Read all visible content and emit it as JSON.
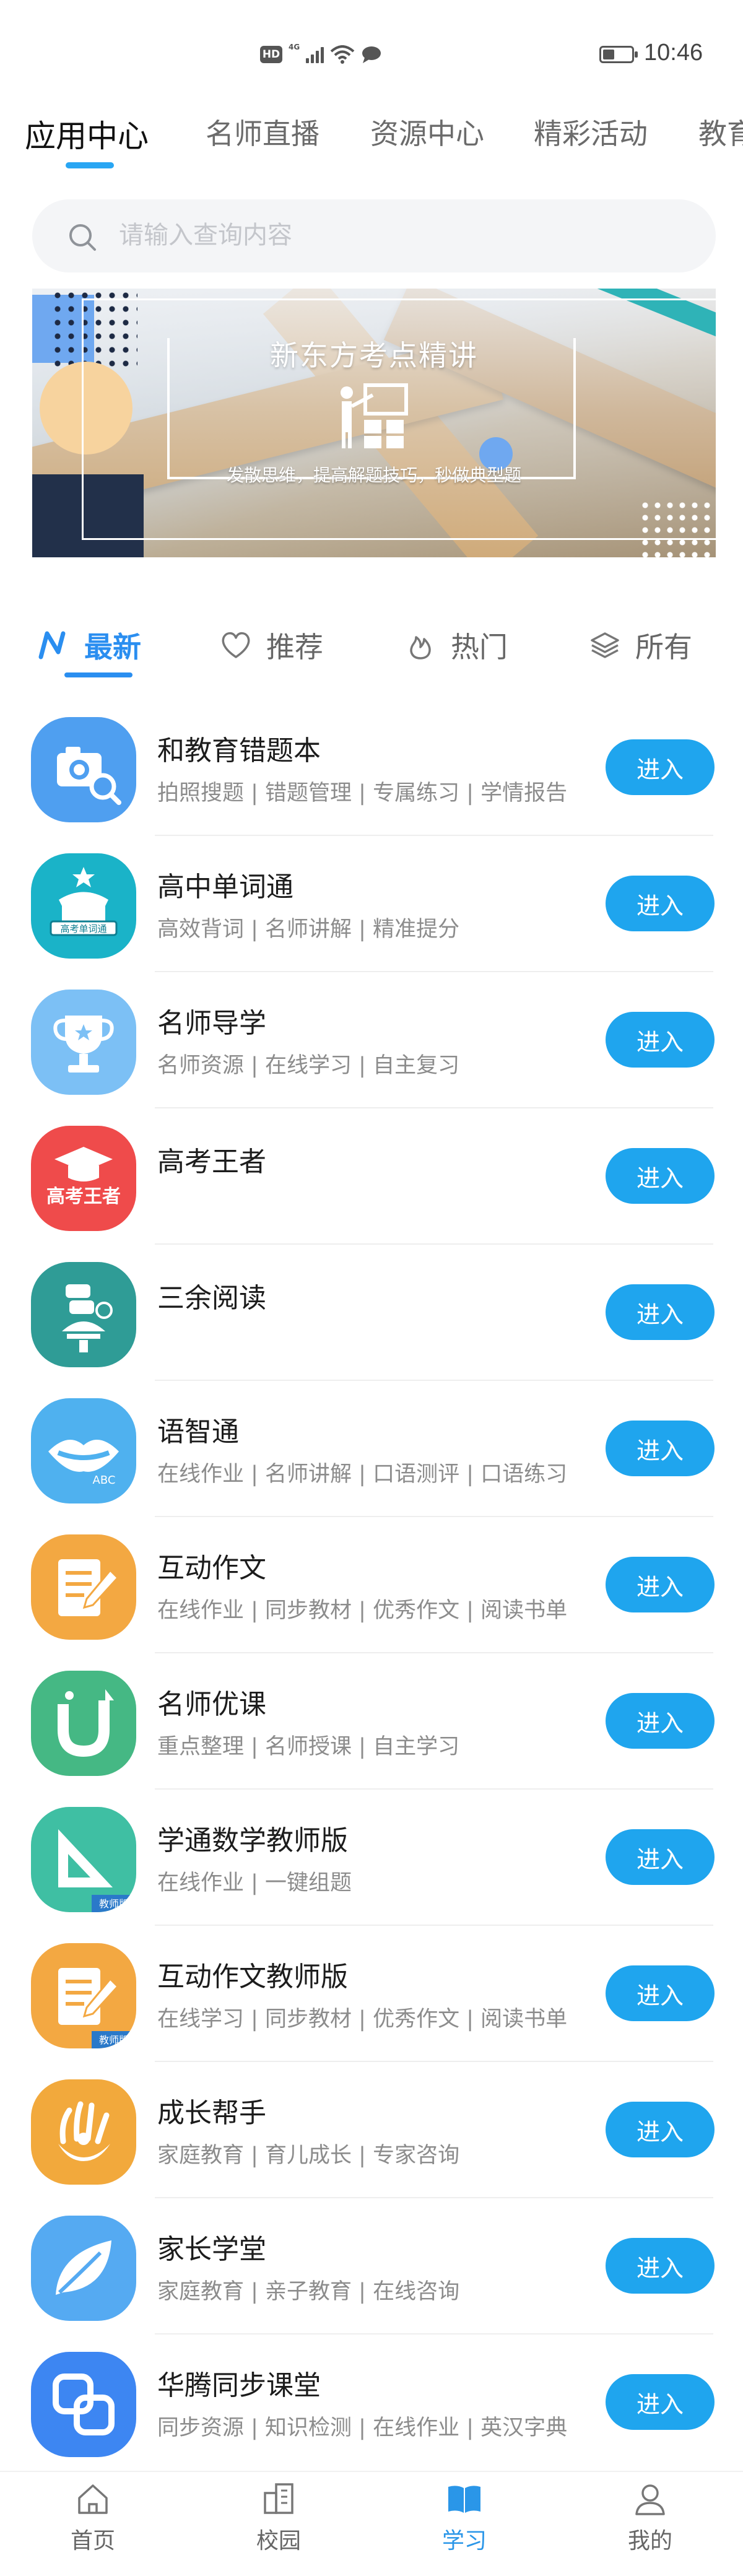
{
  "status_bar": {
    "badge": "HD",
    "network": "4G",
    "time": "10:46"
  },
  "top_tabs": [
    {
      "label": "应用中心",
      "active": true
    },
    {
      "label": "名师直播",
      "active": false
    },
    {
      "label": "资源中心",
      "active": false
    },
    {
      "label": "精彩活动",
      "active": false
    },
    {
      "label": "教育",
      "active": false
    }
  ],
  "search": {
    "placeholder": "请输入查询内容"
  },
  "banner": {
    "title": "新东方考点精讲",
    "subtitle": "发散思维，提高解题技巧，秒做典型题"
  },
  "category_tabs": [
    {
      "label": "最新",
      "icon": "lightning-n-icon",
      "active": true
    },
    {
      "label": "推荐",
      "icon": "heart-icon",
      "active": false
    },
    {
      "label": "热门",
      "icon": "flame-icon",
      "active": false
    },
    {
      "label": "所有",
      "icon": "layers-icon",
      "active": false
    }
  ],
  "enter_label": "进入",
  "apps": [
    {
      "name": "和教育错题本",
      "desc": "拍照搜题 | 错题管理 | 专属练习 | 学情报告",
      "icon": "camera-search-icon"
    },
    {
      "name": "高中单词通",
      "desc": "高效背词 | 名师讲解 | 精准提分",
      "icon": "word-pass-icon",
      "icon_text": "高考单词通"
    },
    {
      "name": "名师导学",
      "desc": "名师资源 | 在线学习 | 自主复习",
      "icon": "trophy-icon"
    },
    {
      "name": "高考王者",
      "desc": "",
      "icon": "graduation-cap-icon",
      "icon_text": "高考王者"
    },
    {
      "name": "三余阅读",
      "desc": "",
      "icon": "reading-icon"
    },
    {
      "name": "语智通",
      "desc": "在线作业 | 名师讲解 | 口语测评 | 口语练习",
      "icon": "speaking-lips-icon",
      "icon_text": "ABC"
    },
    {
      "name": "互动作文",
      "desc": "在线作业 | 同步教材 | 优秀作文 | 阅读书单",
      "icon": "essay-pen-icon"
    },
    {
      "name": "名师优课",
      "desc": "重点整理 | 名师授课 | 自主学习",
      "icon": "magnet-icon"
    },
    {
      "name": "学通数学教师版",
      "desc": "在线作业 | 一键组题",
      "icon": "ruler-triangle-icon",
      "icon_text": "教师版"
    },
    {
      "name": "互动作文教师版",
      "desc": "在线学习 | 同步教材 | 优秀作文 | 阅读书单",
      "icon": "essay-pen-icon",
      "icon_text": "教师版"
    },
    {
      "name": "成长帮手",
      "desc": "家庭教育 | 育儿成长 | 专家咨询",
      "icon": "helping-hand-icon"
    },
    {
      "name": "家长学堂",
      "desc": "家庭教育 | 亲子教育 | 在线咨询",
      "icon": "leaf-icon"
    },
    {
      "name": "华腾同步课堂",
      "desc": "同步资源 | 知识检测 | 在线作业 | 英汉字典",
      "icon": "linked-squares-icon"
    }
  ],
  "bottom_nav": [
    {
      "label": "首页",
      "icon": "home-icon",
      "active": false
    },
    {
      "label": "校园",
      "icon": "campus-building-icon",
      "active": false
    },
    {
      "label": "学习",
      "icon": "book-icon",
      "active": true
    },
    {
      "label": "我的",
      "icon": "person-icon",
      "active": false
    }
  ],
  "colors": {
    "accent": "#1fa5ee",
    "tab_indicator": "#29a6f3",
    "category_active": "#2a8ef0"
  }
}
